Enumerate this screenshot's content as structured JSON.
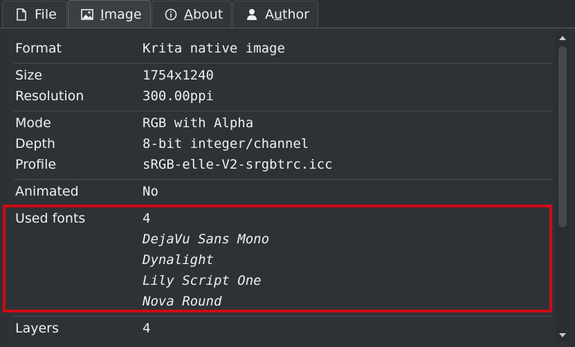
{
  "tabs": [
    {
      "icon": "document-icon",
      "label": "File",
      "active": false
    },
    {
      "icon": "image-icon",
      "label": "Image",
      "active": true,
      "mnemonic": "I"
    },
    {
      "icon": "info-icon",
      "label": "About",
      "active": false,
      "mnemonic": "A"
    },
    {
      "icon": "person-icon",
      "label": "Author",
      "active": false,
      "mnemonic": "u"
    }
  ],
  "tab_parts": {
    "image_u": "I",
    "image_rest": "mage",
    "about_u": "A",
    "about_rest": "bout",
    "author_pre": "A",
    "author_u": "u",
    "author_rest": "thor"
  },
  "properties": {
    "format": {
      "label": "Format",
      "value": "Krita native image"
    },
    "size": {
      "label": "Size",
      "value": "1754x1240"
    },
    "resolution": {
      "label": "Resolution",
      "value": "300.00ppi"
    },
    "mode": {
      "label": "Mode",
      "value": "RGB with Alpha"
    },
    "depth": {
      "label": "Depth",
      "value": "8-bit integer/channel"
    },
    "profile": {
      "label": "Profile",
      "value": "sRGB-elle-V2-srgbtrc.icc"
    },
    "animated": {
      "label": "Animated",
      "value": "No"
    },
    "used_fonts": {
      "label": "Used fonts",
      "count": "4",
      "fonts": [
        "DejaVu Sans Mono",
        "Dynalight",
        "Lily Script One",
        "Nova Round"
      ]
    },
    "layers": {
      "label": "Layers",
      "value": "4"
    }
  },
  "colors": {
    "highlight": "#d10a14",
    "background": "#2e3237"
  }
}
